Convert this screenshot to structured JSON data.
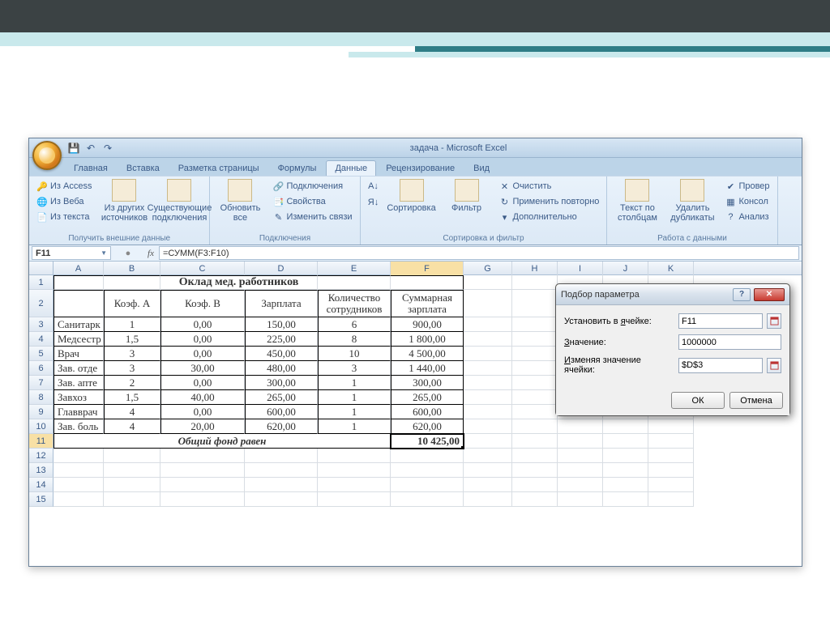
{
  "window_title": "задача - Microsoft Excel",
  "tabs": {
    "home": "Главная",
    "insert": "Вставка",
    "layout": "Разметка страницы",
    "formulas": "Формулы",
    "data": "Данные",
    "review": "Рецензирование",
    "view": "Вид"
  },
  "ribbon": {
    "grp_ext": {
      "access": "Из Access",
      "web": "Из Веба",
      "text": "Из текста",
      "other": "Из других источников",
      "existing": "Существующие подключения",
      "label": "Получить внешние данные"
    },
    "grp_conn": {
      "refresh": "Обновить все",
      "conns": "Подключения",
      "props": "Свойства",
      "links": "Изменить связи",
      "label": "Подключения"
    },
    "grp_sort": {
      "sort": "Сортировка",
      "filter": "Фильтр",
      "clear": "Очистить",
      "reapply": "Применить повторно",
      "adv": "Дополнительно",
      "label": "Сортировка и фильтр"
    },
    "grp_tools": {
      "t2c": "Текст по столбцам",
      "dedup": "Удалить дубликаты",
      "valid": "Провер",
      "consol": "Консол",
      "whatif": "Анализ",
      "label": "Работа с данными"
    }
  },
  "namebox": "F11",
  "formula": "=СУММ(F3:F10)",
  "cols": [
    "A",
    "B",
    "C",
    "D",
    "E",
    "F",
    "G",
    "H",
    "I",
    "J",
    "K"
  ],
  "sheet": {
    "title": "Оклад мед. работников",
    "h_b": "Коэф. А",
    "h_c": "Коэф. В",
    "h_d": "Зарплата",
    "h_e": "Количество сотрудников",
    "h_f": "Суммарная зарплата",
    "rows": [
      {
        "a": "Санитарк",
        "b": "1",
        "c": "0,00",
        "d": "150,00",
        "e": "6",
        "f": "900,00"
      },
      {
        "a": "Медсестр",
        "b": "1,5",
        "c": "0,00",
        "d": "225,00",
        "e": "8",
        "f": "1 800,00"
      },
      {
        "a": "Врач",
        "b": "3",
        "c": "0,00",
        "d": "450,00",
        "e": "10",
        "f": "4 500,00"
      },
      {
        "a": "Зав. отде",
        "b": "3",
        "c": "30,00",
        "d": "480,00",
        "e": "3",
        "f": "1 440,00"
      },
      {
        "a": "Зав. апте",
        "b": "2",
        "c": "0,00",
        "d": "300,00",
        "e": "1",
        "f": "300,00"
      },
      {
        "a": "Завхоз",
        "b": "1,5",
        "c": "40,00",
        "d": "265,00",
        "e": "1",
        "f": "265,00"
      },
      {
        "a": "Главврач",
        "b": "4",
        "c": "0,00",
        "d": "600,00",
        "e": "1",
        "f": "600,00"
      },
      {
        "a": "Зав. боль",
        "b": "4",
        "c": "20,00",
        "d": "620,00",
        "e": "1",
        "f": "620,00"
      }
    ],
    "total_label": "Общий фонд равен",
    "total_value": "10 425,00"
  },
  "dialog": {
    "title": "Подбор параметра",
    "set_cell_lbl": "Установить в ячейке:",
    "set_cell_val": "F11",
    "value_lbl": "Значение:",
    "value_val": "1000000",
    "change_lbl": "Изменяя значение ячейки:",
    "change_val": "$D$3",
    "ok": "ОК",
    "cancel": "Отмена"
  }
}
